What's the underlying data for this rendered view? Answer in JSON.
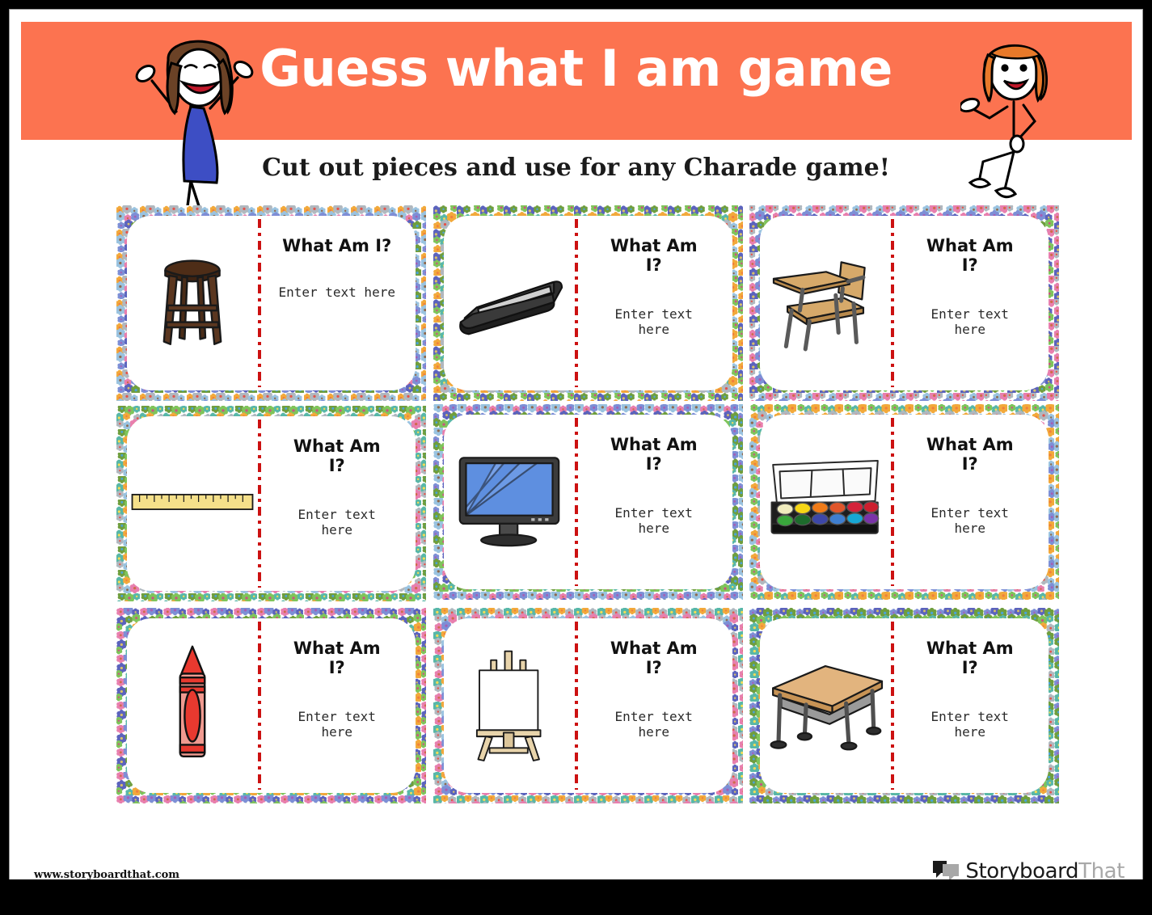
{
  "document": {
    "title": "Guess what I am game",
    "subtitle": "Cut out pieces and use for any Charade game!",
    "accent_color": "#fc7350",
    "title_color": "#ffffff",
    "divider_color": "#cc1111"
  },
  "header": {
    "left_character": "stick-figure-girl-brown-hair-arms-up",
    "right_character": "stick-figure-girl-orange-bob-hair"
  },
  "cards": [
    {
      "id": "card-1",
      "icon": "wooden-stool",
      "question": "What Am I?",
      "placeholder": "Enter text here",
      "single_line": true
    },
    {
      "id": "card-2",
      "icon": "stapler",
      "question": "What Am I?",
      "placeholder": "Enter text here",
      "single_line": false
    },
    {
      "id": "card-3",
      "icon": "school-desk-chair",
      "question": "What Am I?",
      "placeholder": "Enter text here",
      "single_line": false
    },
    {
      "id": "card-4",
      "icon": "ruler",
      "question": "What Am I?",
      "placeholder": "Enter text here",
      "single_line": false
    },
    {
      "id": "card-5",
      "icon": "computer-monitor",
      "question": "What Am I?",
      "placeholder": "Enter text here",
      "single_line": false
    },
    {
      "id": "card-6",
      "icon": "watercolor-paint-set",
      "question": "What Am I?",
      "placeholder": "Enter text here",
      "single_line": false
    },
    {
      "id": "card-7",
      "icon": "red-crayon",
      "question": "What Am I?",
      "placeholder": "Enter text here",
      "single_line": false
    },
    {
      "id": "card-8",
      "icon": "easel-with-canvas",
      "question": "What Am I?",
      "placeholder": "Enter text here",
      "single_line": false
    },
    {
      "id": "card-9",
      "icon": "school-desk",
      "question": "What Am I?",
      "placeholder": "Enter text here",
      "single_line": false
    }
  ],
  "footer": {
    "url": "www.storyboardthat.com",
    "logo_primary": "Storyboard",
    "logo_secondary": "That",
    "logo_icon": "speech-bubbles-icon"
  }
}
